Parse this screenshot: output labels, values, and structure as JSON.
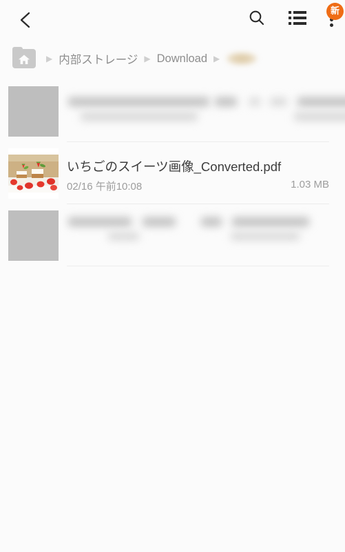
{
  "appbar": {
    "back_icon": "back-chevron-icon",
    "search_icon": "search-icon",
    "listview_icon": "list-view-icon",
    "more_icon": "overflow-menu-icon",
    "new_badge": "新",
    "badge_color": "#ef6c15"
  },
  "breadcrumb": {
    "home_icon": "home-folder-icon",
    "separator": "▶",
    "items": [
      {
        "label": "内部ストレージ",
        "redacted": false
      },
      {
        "label": "Download",
        "redacted": false
      },
      {
        "label": "",
        "redacted": true
      }
    ]
  },
  "list": {
    "rows": [
      {
        "thumb": "placeholder",
        "name": "",
        "date": "",
        "size": "",
        "redacted": true
      },
      {
        "thumb": "strawberry-dessert-photo",
        "name": "いちごのスイーツ画像_Converted.pdf",
        "date": "02/16 午前10:08",
        "size": "1.03 MB",
        "redacted": false
      },
      {
        "thumb": "placeholder",
        "name": "",
        "date": "",
        "size": "",
        "redacted": true
      }
    ]
  },
  "colors": {
    "background": "#fbfbfb",
    "text_primary": "#3c3c3c",
    "text_secondary": "#9d9d9d",
    "crumb_text": "#8e8e8e",
    "divider": "#ececec",
    "placeholder": "#bebebe"
  }
}
